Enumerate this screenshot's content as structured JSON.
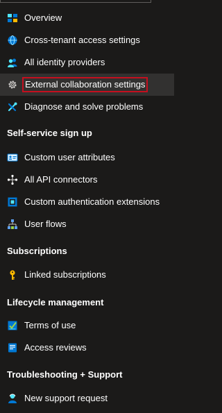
{
  "nav": {
    "items_top": [
      {
        "label": "Overview",
        "icon": "overview-icon"
      },
      {
        "label": "Cross-tenant access settings",
        "icon": "globe-settings-icon"
      },
      {
        "label": "All identity providers",
        "icon": "users-icon"
      },
      {
        "label": "External collaboration settings",
        "icon": "gear-icon",
        "selected": true
      },
      {
        "label": "Diagnose and solve problems",
        "icon": "wrench-icon"
      }
    ],
    "sections": [
      {
        "title": "Self-service sign up",
        "items": [
          {
            "label": "Custom user attributes",
            "icon": "id-card-icon"
          },
          {
            "label": "All API connectors",
            "icon": "connector-icon"
          },
          {
            "label": "Custom authentication extensions",
            "icon": "extension-icon"
          },
          {
            "label": "User flows",
            "icon": "flow-icon"
          }
        ]
      },
      {
        "title": "Subscriptions",
        "items": [
          {
            "label": "Linked subscriptions",
            "icon": "key-icon"
          }
        ]
      },
      {
        "title": "Lifecycle management",
        "items": [
          {
            "label": "Terms of use",
            "icon": "checklist-icon"
          },
          {
            "label": "Access reviews",
            "icon": "review-icon"
          }
        ]
      },
      {
        "title": "Troubleshooting + Support",
        "items": [
          {
            "label": "New support request",
            "icon": "support-person-icon"
          }
        ]
      }
    ]
  },
  "colors": {
    "background": "#1b1a19",
    "selected_background": "#323130",
    "highlight_border": "#c50f1f",
    "accent_blue": "#0078d4",
    "accent_yellow": "#ffb900"
  }
}
